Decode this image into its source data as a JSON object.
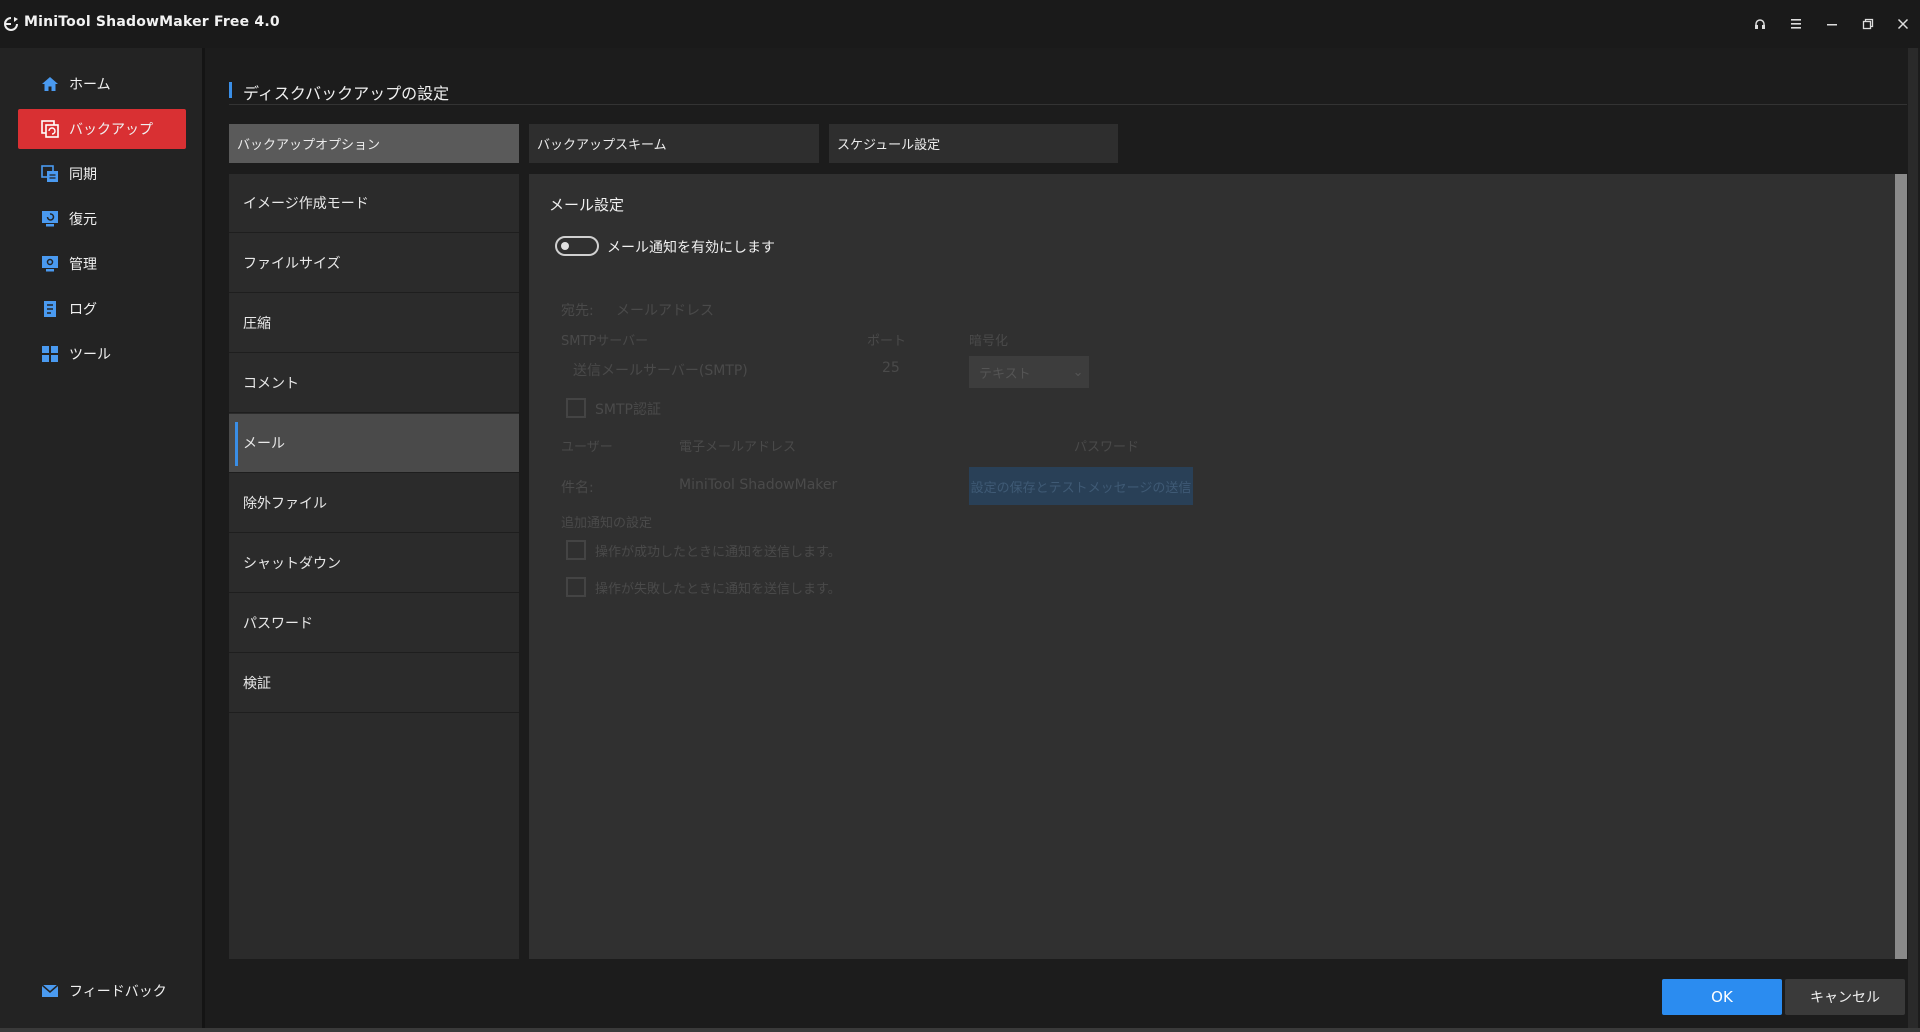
{
  "window": {
    "title": "MiniTool ShadowMaker Free 4.0",
    "controls": [
      "headset-icon",
      "menu-icon",
      "minimize-icon",
      "restore-icon",
      "close-icon"
    ]
  },
  "sidebar": {
    "items": [
      {
        "label": "ホーム",
        "icon": "home-icon"
      },
      {
        "label": "バックアップ",
        "icon": "backup-icon",
        "active": true
      },
      {
        "label": "同期",
        "icon": "sync-icon"
      },
      {
        "label": "復元",
        "icon": "restore-icon"
      },
      {
        "label": "管理",
        "icon": "manage-icon"
      },
      {
        "label": "ログ",
        "icon": "log-icon"
      },
      {
        "label": "ツール",
        "icon": "tools-icon"
      }
    ],
    "feedback": {
      "label": "フィードバック",
      "icon": "mail-icon"
    },
    "accent": "#d93033"
  },
  "page": {
    "title": "ディスクバックアップの設定"
  },
  "tabs": [
    {
      "label": "バックアップオプション",
      "active": true
    },
    {
      "label": "バックアップスキーム"
    },
    {
      "label": "スケジュール設定"
    }
  ],
  "options": [
    {
      "label": "イメージ作成モード"
    },
    {
      "label": "ファイルサイズ"
    },
    {
      "label": "圧縮"
    },
    {
      "label": "コメント"
    },
    {
      "label": "メール",
      "active": true
    },
    {
      "label": "除外ファイル"
    },
    {
      "label": "シャットダウン"
    },
    {
      "label": "パスワード"
    },
    {
      "label": "検証"
    }
  ],
  "mail": {
    "section_title": "メール設定",
    "toggle_label": "メール通知を有効にします",
    "toggle_on": false,
    "to_label": "宛先:",
    "to_placeholder": "メールアドレス",
    "smtp_label": "SMTPサーバー",
    "smtp_placeholder": "送信メールサーバー(SMTP)",
    "port_label": "ポート",
    "port_value": "25",
    "encrypt_label": "暗号化",
    "encrypt_value": "テキスト",
    "smtp_auth_label": "SMTP認証",
    "user_label": "ユーザー",
    "user_placeholder": "電子メールアドレス",
    "password_label": "パスワード",
    "subject_label": "件名:",
    "subject_value": "MiniTool ShadowMaker",
    "save_test_button": "設定の保存とテストメッセージの送信",
    "additional_label": "追加通知の設定",
    "notify_success": "操作が成功したときに通知を送信します。",
    "notify_fail": "操作が失敗したときに通知を送信します。"
  },
  "footer": {
    "ok": "OK",
    "cancel": "キャンセル"
  },
  "colors": {
    "primary": "#2b8cf0",
    "tab_indicator": "#3a8ee6"
  }
}
